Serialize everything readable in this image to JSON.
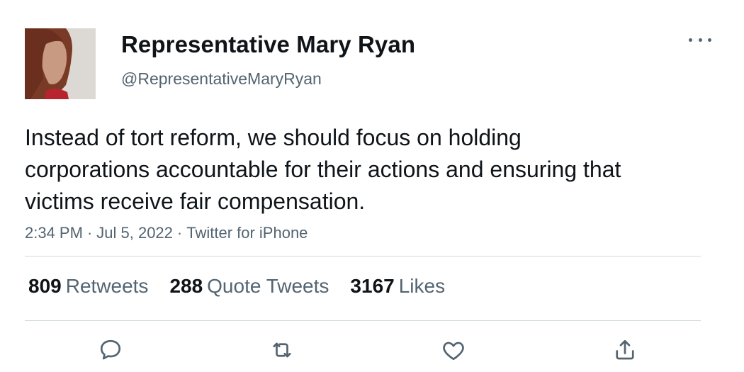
{
  "author": {
    "display_name": "Representative Mary Ryan",
    "handle": "@RepresentativeMaryRyan"
  },
  "tweet": {
    "text": "Instead of tort reform, we should focus on holding corporations accountable for their actions and ensuring that victims receive fair compensation.",
    "time": "2:34 PM",
    "date": "Jul 5, 2022",
    "source": "Twitter for iPhone",
    "separator": "·"
  },
  "stats": {
    "retweets": {
      "count": "809",
      "label": "Retweets"
    },
    "quotes": {
      "count": "288",
      "label": "Quote Tweets"
    },
    "likes": {
      "count": "3167",
      "label": "Likes"
    }
  },
  "actions": [
    "reply-icon",
    "retweet-icon",
    "like-icon",
    "share-icon"
  ],
  "colors": {
    "text_primary": "#0f1419",
    "text_secondary": "#536471",
    "divider": "#cfd9de"
  }
}
